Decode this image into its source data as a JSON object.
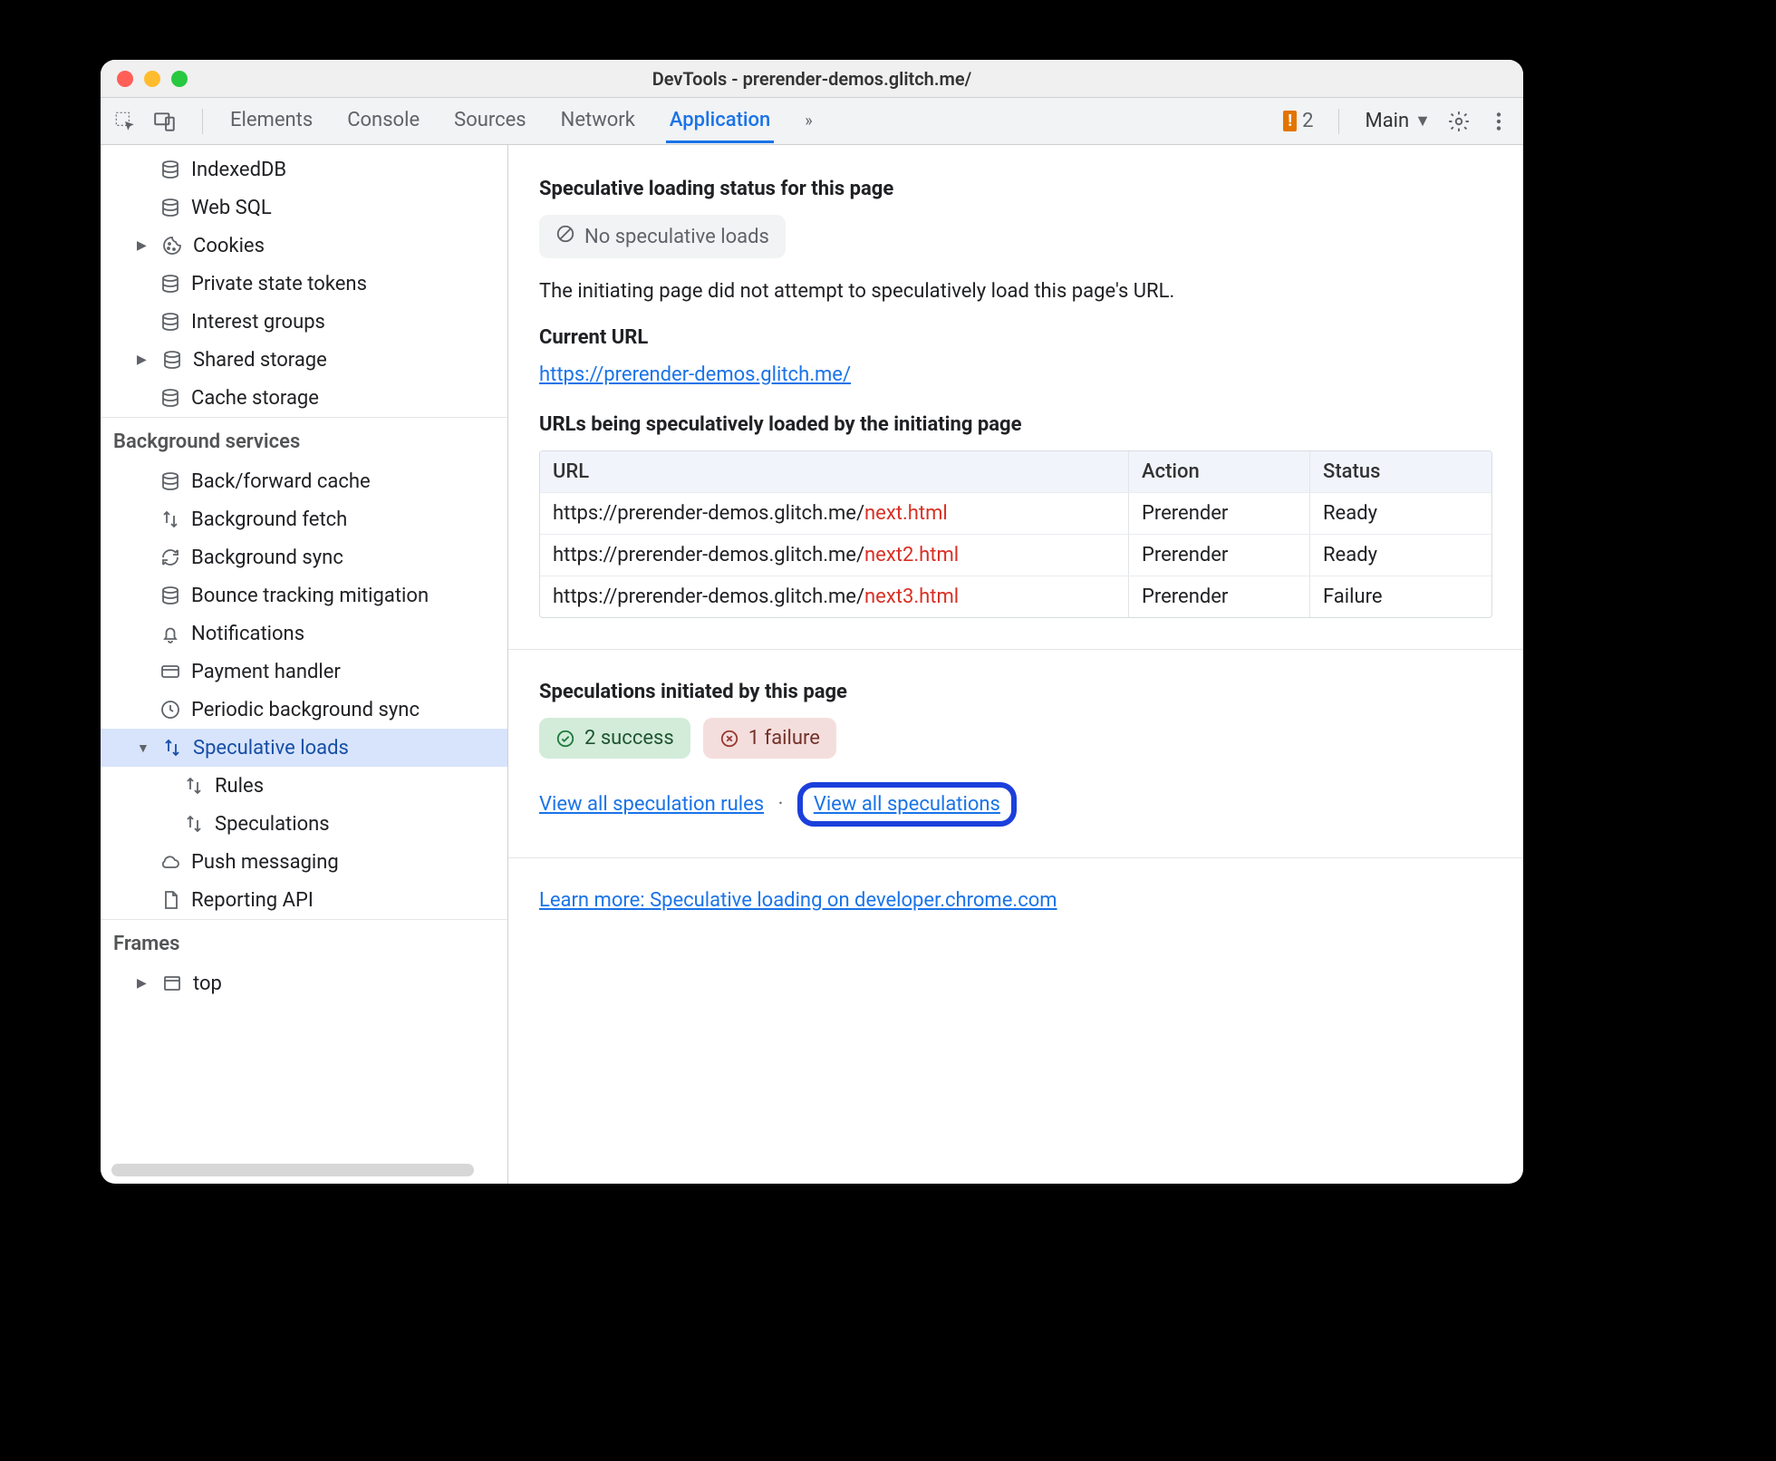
{
  "window": {
    "title": "DevTools - prerender-demos.glitch.me/"
  },
  "toolbar": {
    "tabs": [
      "Elements",
      "Console",
      "Sources",
      "Network",
      "Application"
    ],
    "active_index": 4,
    "warning_count": "2",
    "target_label": "Main"
  },
  "sidebar": {
    "storage_items": [
      {
        "label": "IndexedDB",
        "icon": "db"
      },
      {
        "label": "Web SQL",
        "icon": "db"
      },
      {
        "label": "Cookies",
        "icon": "cookie",
        "expandable": true
      },
      {
        "label": "Private state tokens",
        "icon": "db"
      },
      {
        "label": "Interest groups",
        "icon": "db"
      },
      {
        "label": "Shared storage",
        "icon": "db",
        "expandable": true
      },
      {
        "label": "Cache storage",
        "icon": "db"
      }
    ],
    "bg_title": "Background services",
    "bg_items": [
      {
        "label": "Back/forward cache",
        "icon": "db"
      },
      {
        "label": "Background fetch",
        "icon": "updown"
      },
      {
        "label": "Background sync",
        "icon": "sync"
      },
      {
        "label": "Bounce tracking mitigation",
        "icon": "db"
      },
      {
        "label": "Notifications",
        "icon": "bell"
      },
      {
        "label": "Payment handler",
        "icon": "card"
      },
      {
        "label": "Periodic background sync",
        "icon": "clock"
      },
      {
        "label": "Speculative loads",
        "icon": "updown",
        "expanded": true,
        "selected": true,
        "children": [
          {
            "label": "Rules",
            "icon": "updown"
          },
          {
            "label": "Speculations",
            "icon": "updown"
          }
        ]
      },
      {
        "label": "Push messaging",
        "icon": "cloud"
      },
      {
        "label": "Reporting API",
        "icon": "doc"
      }
    ],
    "frames_title": "Frames",
    "frames_items": [
      {
        "label": "top",
        "icon": "window",
        "expandable": true
      }
    ]
  },
  "content": {
    "status_heading": "Speculative loading status for this page",
    "status_pill": "No speculative loads",
    "status_para": "The initiating page did not attempt to speculatively load this page's URL.",
    "current_url_heading": "Current URL",
    "current_url": "https://prerender-demos.glitch.me/",
    "urls_heading": "URLs being speculatively loaded by the initiating page",
    "table": {
      "headers": [
        "URL",
        "Action",
        "Status"
      ],
      "rows": [
        {
          "base": "https://prerender-demos.glitch.me/",
          "suffix": "next.html",
          "action": "Prerender",
          "status": "Ready"
        },
        {
          "base": "https://prerender-demos.glitch.me/",
          "suffix": "next2.html",
          "action": "Prerender",
          "status": "Ready"
        },
        {
          "base": "https://prerender-demos.glitch.me/",
          "suffix": "next3.html",
          "action": "Prerender",
          "status": "Failure"
        }
      ]
    },
    "spec_heading": "Speculations initiated by this page",
    "success_badge": "2 success",
    "failure_badge": "1 failure",
    "link_rules": "View all speculation rules",
    "link_specs": "View all speculations",
    "learn_more": "Learn more: Speculative loading on developer.chrome.com"
  }
}
